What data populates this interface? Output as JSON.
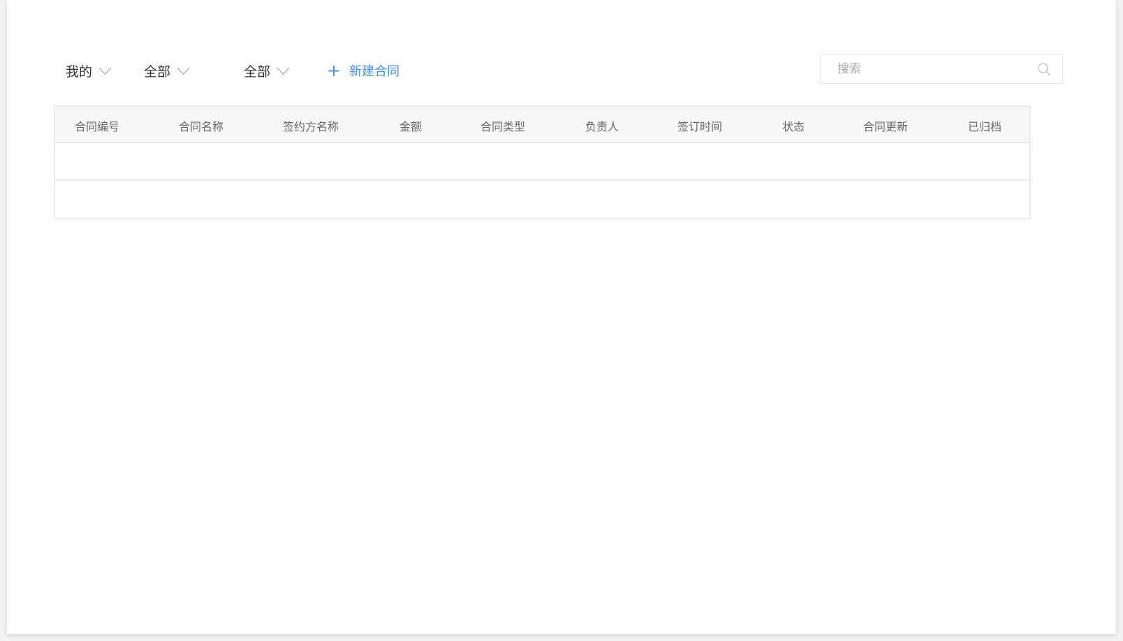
{
  "toolbar": {
    "filters": [
      {
        "label": "我的"
      },
      {
        "label": "全部"
      },
      {
        "label": "全部"
      }
    ],
    "new_contract_label": "新建合同",
    "search": {
      "placeholder": "搜索",
      "value": ""
    }
  },
  "table": {
    "columns": [
      "合同编号",
      "合同名称",
      "签约方名称",
      "金额",
      "合同类型",
      "负责人",
      "签订时间",
      "状态",
      "合同更新",
      "已归档"
    ],
    "rows": [
      [],
      []
    ]
  },
  "colors": {
    "accent": "#4a90e2",
    "text": "#333333",
    "header_text": "#666666",
    "border": "#ebebeb",
    "header_bg": "#f7f7f7"
  },
  "icons": {
    "filter_arrow": "chevron-down-icon",
    "new": "plus-icon",
    "search": "search-icon"
  }
}
